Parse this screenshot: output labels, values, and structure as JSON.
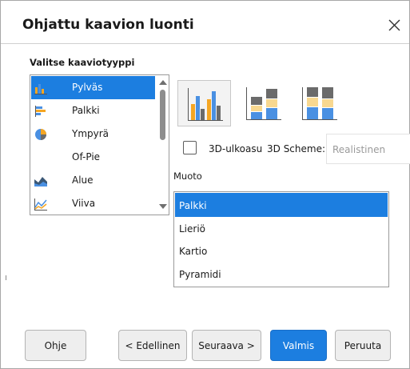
{
  "dialog": {
    "title": "Ohjattu kaavion luonti",
    "close_label": "Close"
  },
  "chart_type": {
    "section_label": "Valitse kaaviotyyppi",
    "items": [
      {
        "label": "Pylväs",
        "icon": "column-chart-icon",
        "selected": true
      },
      {
        "label": "Palkki",
        "icon": "bar-chart-icon",
        "selected": false
      },
      {
        "label": "Ympyrä",
        "icon": "pie-chart-icon",
        "selected": false
      },
      {
        "label": "Of-Pie",
        "icon": "",
        "selected": false
      },
      {
        "label": "Alue",
        "icon": "area-chart-icon",
        "selected": false
      },
      {
        "label": "Viiva",
        "icon": "line-chart-icon",
        "selected": false
      }
    ]
  },
  "variants": [
    {
      "name": "normal",
      "selected": true
    },
    {
      "name": "stacked",
      "selected": false
    },
    {
      "name": "percent-stacked",
      "selected": false
    }
  ],
  "three_d": {
    "checkbox_label": "3D-ulkoasu",
    "checked": false,
    "scheme_label": "3D Scheme:",
    "scheme_value": "Realistinen"
  },
  "shape": {
    "label": "Muoto",
    "items": [
      {
        "label": "Palkki",
        "selected": true
      },
      {
        "label": "Lieriö",
        "selected": false
      },
      {
        "label": "Kartio",
        "selected": false
      },
      {
        "label": "Pyramidi",
        "selected": false
      }
    ]
  },
  "buttons": {
    "help": "Ohje",
    "previous": "< Edellinen",
    "next": "Seuraava >",
    "finish": "Valmis",
    "cancel": "Peruuta"
  },
  "colors": {
    "accent": "#1c7ee0",
    "bar_orange": "#f5a623",
    "bar_blue": "#4a90e2",
    "bar_gray": "#6b6b6b",
    "bar_light": "#f8d890"
  }
}
